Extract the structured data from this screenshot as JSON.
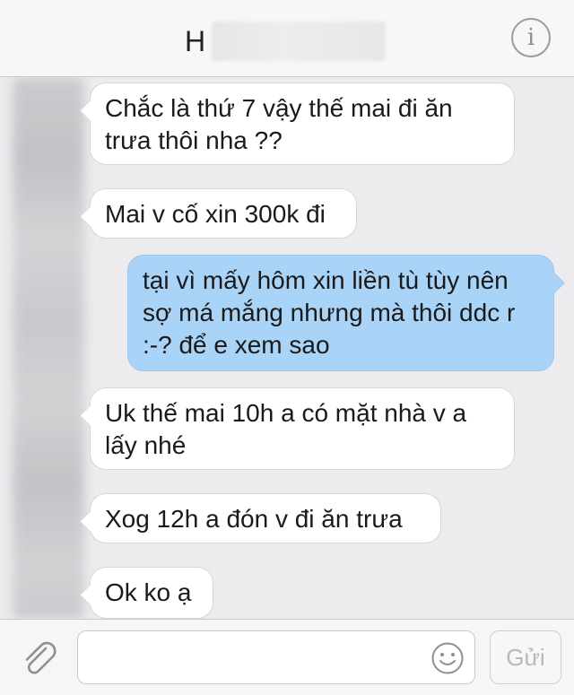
{
  "header": {
    "contact_initial": "H",
    "info_glyph": "i"
  },
  "messages": [
    {
      "direction": "incoming",
      "text": "Chắc là thứ 7 vậy thế mai đi ăn trưa thôi nha ??"
    },
    {
      "direction": "incoming",
      "text": "Mai v cố xin 300k đi"
    },
    {
      "direction": "outgoing",
      "text": "tại vì mấy hôm xin liền tù tùy nên sợ má mắng nhưng mà thôi ddc r :-? để e xem sao"
    },
    {
      "direction": "incoming",
      "text": "Uk thế mai 10h a có mặt nhà v a lấy nhé"
    },
    {
      "direction": "incoming",
      "text": "Xog 12h a đón v đi ăn trưa"
    },
    {
      "direction": "incoming",
      "text": "Ok ko ạ"
    }
  ],
  "composer": {
    "input_value": "",
    "send_label": "Gửi",
    "attach_icon": "paperclip-icon",
    "emoji_icon": "smiley-icon"
  },
  "colors": {
    "outgoing_bubble": "#a9d4f7",
    "incoming_bubble": "#ffffff",
    "background": "#ececee"
  }
}
